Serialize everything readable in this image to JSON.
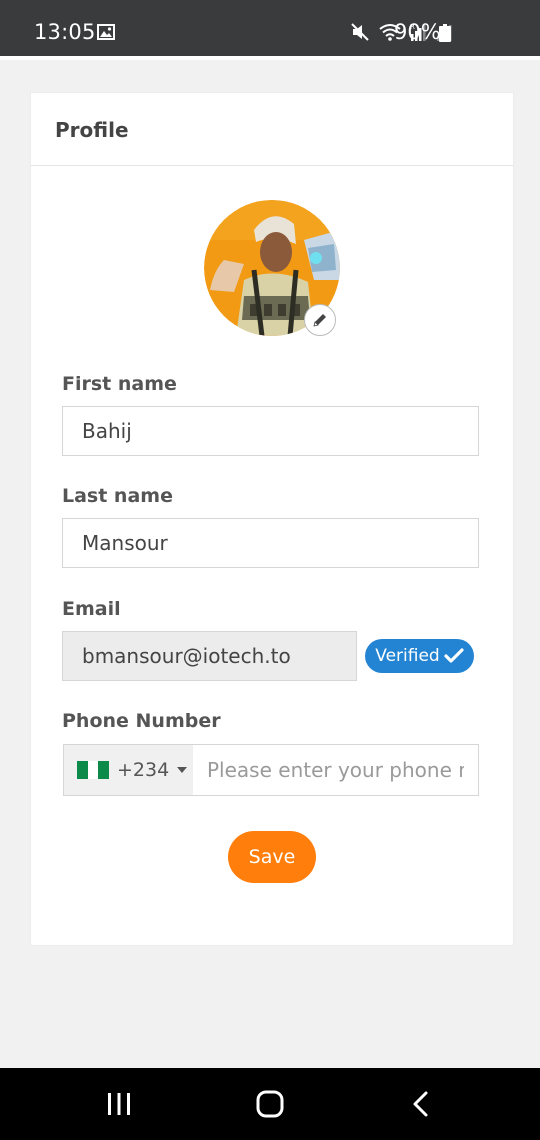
{
  "status_bar": {
    "time": "13:05",
    "battery": "90%",
    "icons": [
      "gallery-icon",
      "mute-icon",
      "wifi-icon",
      "signal-icon",
      "signal-weak-icon",
      "battery-icon"
    ]
  },
  "profile": {
    "title": "Profile",
    "avatar_edit_icon": "pencil-icon"
  },
  "form": {
    "first_name": {
      "label": "First name",
      "value": "Bahij"
    },
    "last_name": {
      "label": "Last name",
      "value": "Mansour"
    },
    "email": {
      "label": "Email",
      "value": "bmansour@iotech.to",
      "badge": "Verified"
    },
    "phone": {
      "label": "Phone Number",
      "country_code": "+234",
      "country_flag": "nigeria-flag",
      "placeholder": "Please enter your phone number",
      "value": ""
    },
    "save_label": "Save"
  },
  "colors": {
    "accent_orange": "#ff7e0c",
    "verified_blue": "#2384d3",
    "status_bar": "#3a3b3d"
  },
  "nav_bar": {
    "icons": [
      "recent-apps-icon",
      "home-icon",
      "back-icon"
    ]
  }
}
